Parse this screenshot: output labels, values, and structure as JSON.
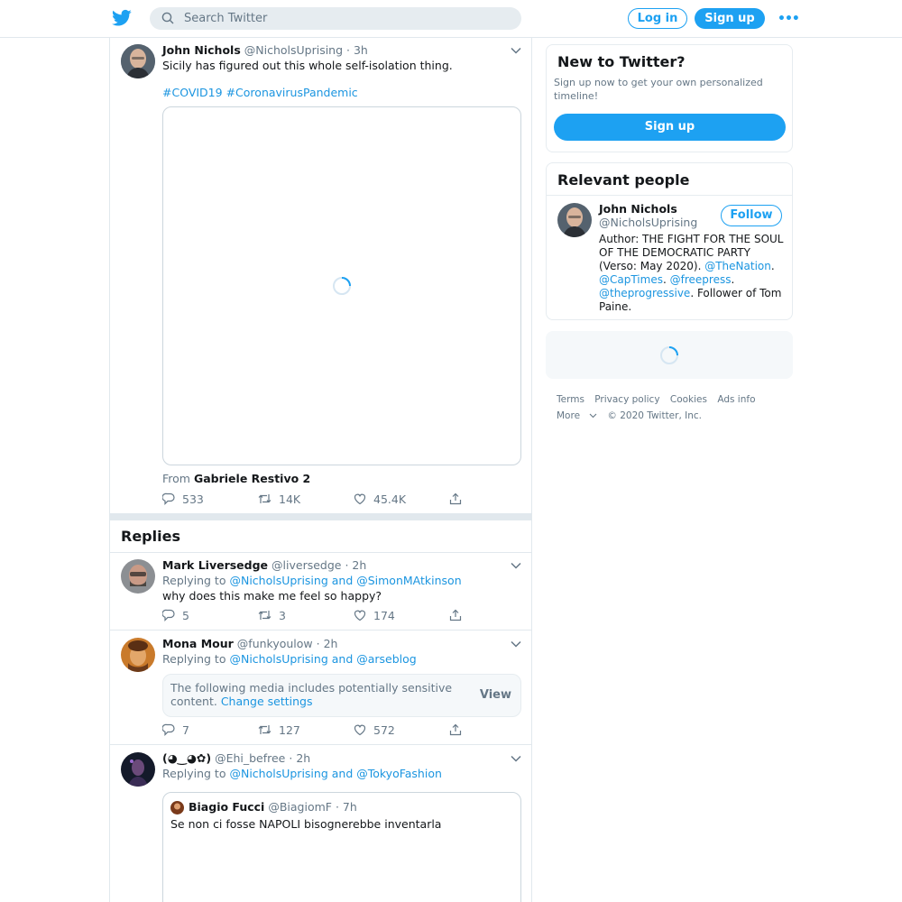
{
  "topbar": {
    "search_placeholder": "Search Twitter",
    "login_label": "Log in",
    "signup_label": "Sign up",
    "more_label": "•••"
  },
  "tweet": {
    "name": "John Nichols",
    "handle": "@NicholsUprising",
    "time": "· 3h",
    "text": "Sicily has figured out this whole self-isolation thing.",
    "hashtag1": "#COVID19",
    "hashtag2": "#CoronavirusPandemic",
    "from_prefix": "From",
    "from_name": "Gabriele Restivo 2",
    "replies": "533",
    "retweets": "14K",
    "likes": "45.4K"
  },
  "replies_title": "Replies",
  "replies": [
    {
      "name": "Mark Liversedge",
      "handle": "@liversedge",
      "time": "· 2h",
      "replying_prefix": "Replying to",
      "replying_to": "@NicholsUprising and @SimonMAtkinson",
      "text": "why does this make me feel so happy?",
      "replies": "5",
      "retweets": "3",
      "likes": "174"
    },
    {
      "name": "Mona Mour",
      "handle": "@funkyoulow",
      "time": "· 2h",
      "replying_prefix": "Replying to",
      "replying_to": "@NicholsUprising and @arseblog",
      "sensitive_text": "The following media includes potentially sensitive content.",
      "change_settings": "Change settings",
      "view_label": "View",
      "replies": "7",
      "retweets": "127",
      "likes": "572"
    },
    {
      "name": "(◕‿◕✿)",
      "handle": "@Ehi_befree",
      "time": "· 2h",
      "replying_prefix": "Replying to",
      "replying_to": "@NicholsUprising and @TokyoFashion",
      "quote": {
        "name": "Biagio Fucci",
        "handle": "@BiagiomF",
        "time": "· 7h",
        "text": "Se non ci fosse NAPOLI bisognerebbe inventarla"
      }
    }
  ],
  "sidebar": {
    "new_title": "New to Twitter?",
    "new_desc": "Sign up now to get your own personalized timeline!",
    "new_signup": "Sign up",
    "people_title": "Relevant people",
    "person_name": "John Nichols",
    "person_handle": "@NicholsUprising",
    "follow_label": "Follow",
    "bio_1": "Author: THE FIGHT FOR THE SOUL OF THE DEMOCRATIC PARTY (Verso: May 2020).",
    "bio_m1": "@TheNation",
    "bio_dot1": ".",
    "bio_m2": "@CapTimes",
    "bio_dot2": ".",
    "bio_m3": "@freepress",
    "bio_dot3": ".",
    "bio_m4": "@theprogressive",
    "bio_2": ". Follower of Tom Paine."
  },
  "footer": {
    "terms": "Terms",
    "privacy": "Privacy policy",
    "cookies": "Cookies",
    "ads": "Ads info",
    "more": "More",
    "copyright": "© 2020 Twitter, Inc."
  },
  "colors": {
    "accent": "#1da1f2",
    "link": "#1b95e0",
    "muted": "#657786",
    "border": "#e1e8ed"
  },
  "icons": [
    "twitter-bird-icon",
    "search-icon",
    "chevron-down-icon",
    "reply-icon",
    "retweet-icon",
    "like-icon",
    "share-icon",
    "loading-spinner-icon"
  ]
}
